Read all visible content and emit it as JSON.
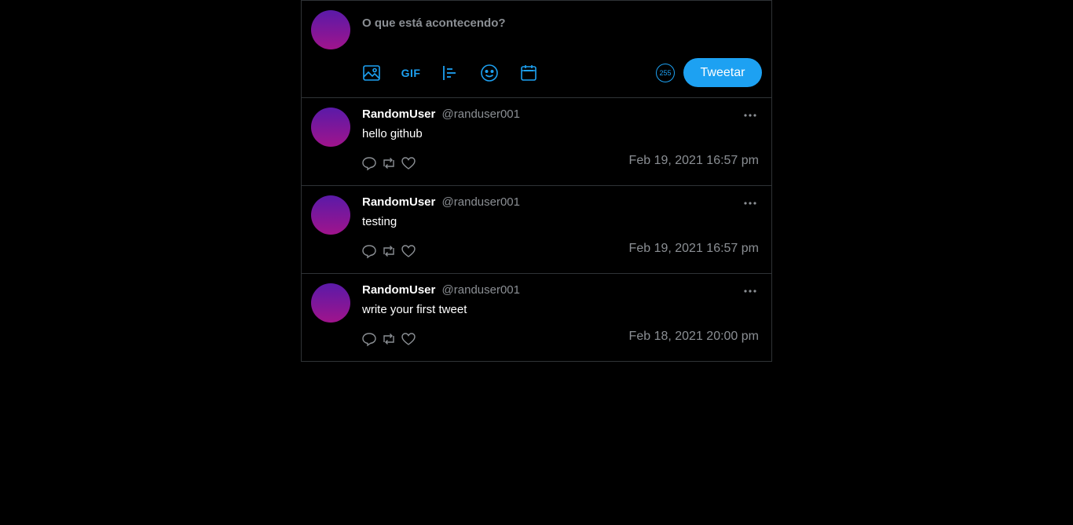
{
  "composer": {
    "placeholder": "O que está acontecendo?",
    "tools": [
      "image-icon",
      "gif-icon",
      "poll-icon",
      "emoji-icon",
      "schedule-icon"
    ],
    "gif_label": "GIF",
    "char_count": "255",
    "tweet_button": "Tweetar"
  },
  "colors": {
    "accent": "#1da1f2",
    "background": "#000000",
    "border": "#2f3336",
    "muted": "#8b8f94"
  },
  "tweets": [
    {
      "name": "RandomUser",
      "handle": "@randuser001",
      "text": "hello github",
      "timestamp": "Feb 19, 2021 16:57 pm"
    },
    {
      "name": "RandomUser",
      "handle": "@randuser001",
      "text": "testing",
      "timestamp": "Feb 19, 2021 16:57 pm"
    },
    {
      "name": "RandomUser",
      "handle": "@randuser001",
      "text": "write your first tweet",
      "timestamp": "Feb 18, 2021 20:00 pm"
    }
  ]
}
